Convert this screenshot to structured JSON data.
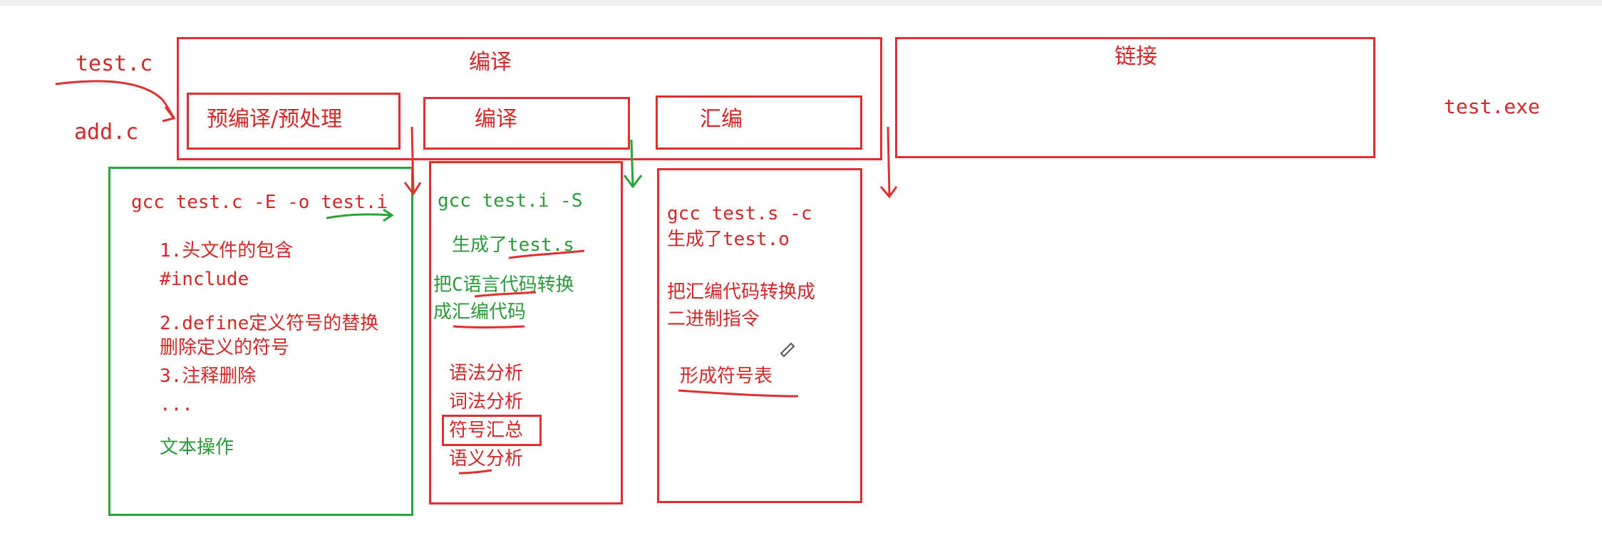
{
  "inputs": {
    "file1": "test.c",
    "file2": "add.c"
  },
  "compile_group": {
    "title": "编译",
    "stages": {
      "precompile": "预编译/预处理",
      "compile": "编译",
      "assemble": "汇编"
    }
  },
  "link": {
    "title": "链接"
  },
  "output": {
    "file": "test.exe"
  },
  "precompile_panel": {
    "command": "gcc test.c -E -o test.i",
    "lines": [
      "1.头文件的包含",
      "#include",
      "2.define定义符号的替换",
      "删除定义的符号",
      "3.注释删除",
      "..."
    ],
    "summary": "文本操作"
  },
  "compile_panel": {
    "command": "gcc test.i -S",
    "result": "生成了test.s",
    "desc1": "把C语言代码转换",
    "desc2": "成汇编代码",
    "steps": [
      "语法分析",
      "词法分析",
      "符号汇总",
      "语义分析"
    ]
  },
  "assemble_panel": {
    "command": "gcc test.s -c",
    "result": "生成了test.o",
    "desc1": "把汇编代码转换成",
    "desc2": "二进制指令",
    "summary": "形成符号表"
  },
  "colors": {
    "red": "#e03030",
    "green": "#2aa43a",
    "ink_red": "#d42828",
    "ink_green": "#2a9a3a"
  }
}
